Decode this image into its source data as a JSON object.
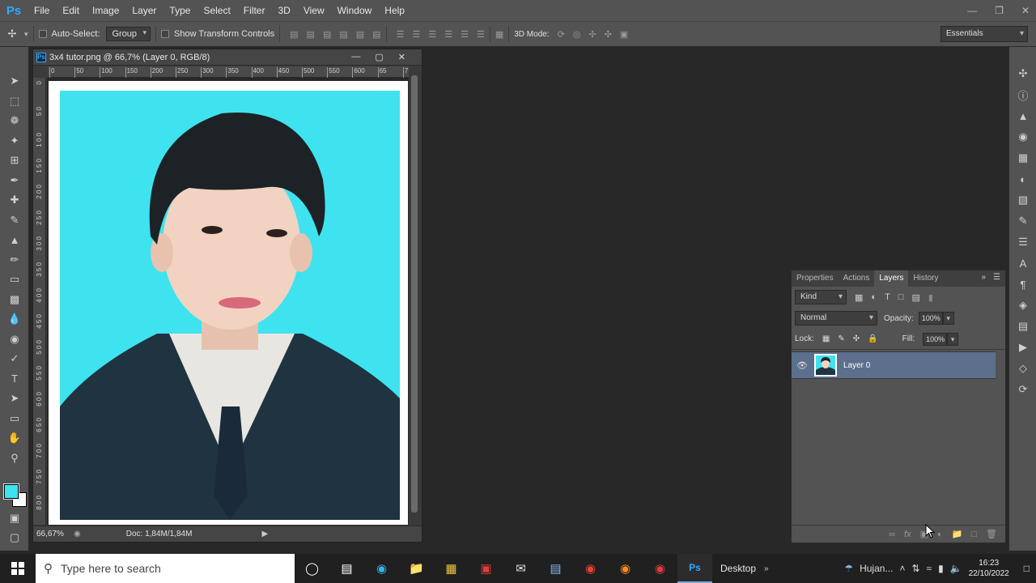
{
  "app": {
    "logo": "Ps"
  },
  "menu": [
    "File",
    "Edit",
    "Image",
    "Layer",
    "Type",
    "Select",
    "Filter",
    "3D",
    "View",
    "Window",
    "Help"
  ],
  "options": {
    "auto_select_label": "Auto-Select:",
    "auto_select_value": "Group",
    "transform_label": "Show Transform Controls",
    "mode_label": "3D Mode:",
    "workspace": "Essentials"
  },
  "document": {
    "title": "3x4 tutor.png @ 66,7% (Layer 0, RGB/8)",
    "zoom": "66,67%",
    "doc_size": "Doc: 1,84M/1,84M",
    "h_ruler": [
      "0",
      "50",
      "100",
      "150",
      "200",
      "250",
      "300",
      "350",
      "400",
      "450",
      "500",
      "550",
      "600",
      "65",
      "7"
    ],
    "v_ruler": [
      "0",
      "5 0",
      "1 0 0",
      "1 5 0",
      "2 0 0",
      "2 5 0",
      "3 0 0",
      "3 5 0",
      "4 0 0",
      "4 5 0",
      "5 0 0",
      "5 5 0",
      "6 0 0",
      "6 5 0",
      "7 0 0",
      "7 5 0",
      "8 0 0"
    ]
  },
  "colors": {
    "foreground": "#3ee3ef",
    "background": "#ffffff",
    "photo_bg": "#3ee3ef",
    "layer_selected": "#5c6f8c"
  },
  "layers_panel": {
    "tabs": [
      "Properties",
      "Actions",
      "Layers",
      "History"
    ],
    "active_tab": "Layers",
    "kind": "Kind",
    "blend_mode": "Normal",
    "opacity_label": "Opacity:",
    "opacity": "100%",
    "lock_label": "Lock:",
    "fill_label": "Fill:",
    "fill": "100%",
    "layers": [
      {
        "name": "Layer 0",
        "visible": true
      }
    ],
    "footer_icons": [
      "link-icon",
      "fx-icon",
      "mask-icon",
      "adjustment-icon",
      "group-icon",
      "new-layer-icon",
      "trash-icon"
    ]
  },
  "taskbar": {
    "search_placeholder": "Type here to search",
    "desktop_label": "Desktop",
    "weather": "Hujan...",
    "time": "16:23",
    "date": "22/10/2022"
  }
}
